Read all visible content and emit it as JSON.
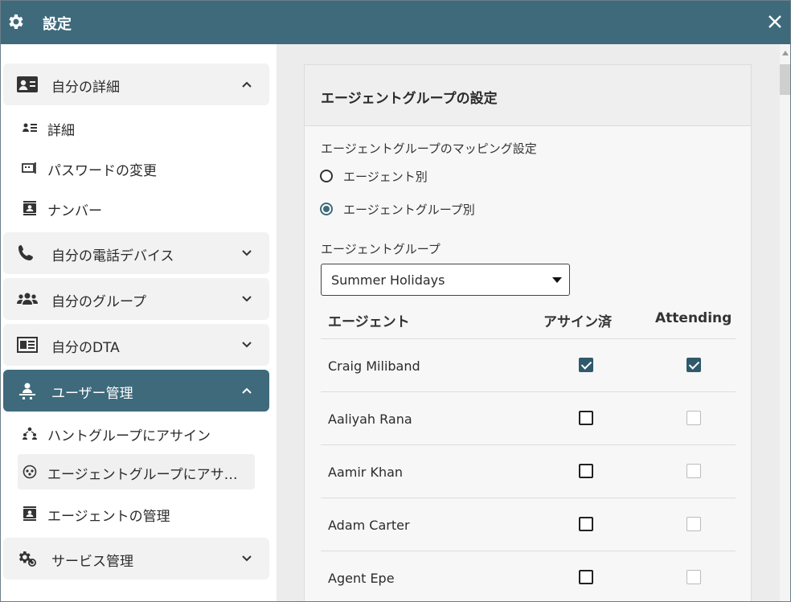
{
  "window": {
    "title": "設定"
  },
  "sidebar": {
    "sections": [
      {
        "label": "自分の詳細",
        "expanded": true,
        "icon": "contact-card-icon"
      },
      {
        "label": "自分の電話デバイス",
        "expanded": false,
        "icon": "phone-icon"
      },
      {
        "label": "自分のグループ",
        "expanded": false,
        "icon": "group-icon"
      },
      {
        "label": "自分のDTA",
        "expanded": false,
        "icon": "dta-icon"
      },
      {
        "label": "ユーザー管理",
        "expanded": true,
        "icon": "user-admin-icon"
      },
      {
        "label": "サービス管理",
        "expanded": false,
        "icon": "service-gear-icon"
      }
    ],
    "my_details_items": [
      {
        "label": "詳細",
        "icon": "details-list-icon"
      },
      {
        "label": "パスワードの変更",
        "icon": "password-icon"
      },
      {
        "label": "ナンバー",
        "icon": "number-icon"
      }
    ],
    "user_admin_items": [
      {
        "label": "ハントグループにアサイン",
        "icon": "hunt-group-icon"
      },
      {
        "label": "エージェントグループにアサイン",
        "icon": "agent-group-icon",
        "selected": true
      },
      {
        "label": "エージェントの管理",
        "icon": "agent-manage-icon"
      }
    ]
  },
  "main": {
    "panel_title": "エージェントグループの設定",
    "mapping_label": "エージェントグループのマッピング設定",
    "radio_options": [
      {
        "label": "エージェント別",
        "checked": false
      },
      {
        "label": "エージェントグループ別",
        "checked": true
      }
    ],
    "group_label": "エージェントグループ",
    "group_select_value": "Summer Holidays",
    "table": {
      "headers": [
        "エージェント",
        "アサイン済",
        "Attending"
      ],
      "rows": [
        {
          "name": "Craig Miliband",
          "assigned": true,
          "attending": true
        },
        {
          "name": "Aaliyah Rana",
          "assigned": false,
          "attending": false
        },
        {
          "name": "Aamir Khan",
          "assigned": false,
          "attending": false
        },
        {
          "name": "Adam Carter",
          "assigned": false,
          "attending": false
        },
        {
          "name": "Agent Epe",
          "assigned": false,
          "attending": false
        }
      ]
    }
  },
  "colors": {
    "accent": "#3e6a7c",
    "checkbox_checked": "#2f5a6c",
    "background": "#ececec"
  }
}
